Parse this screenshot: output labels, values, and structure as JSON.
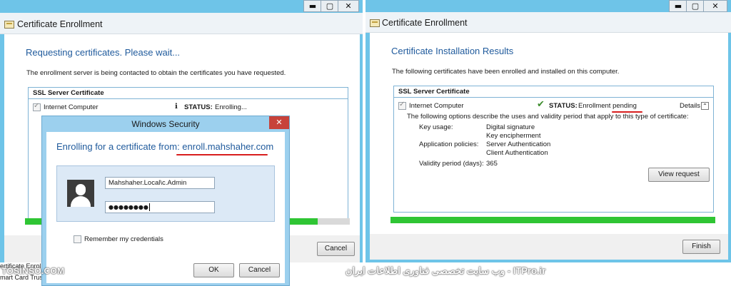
{
  "left_window": {
    "title": "Certificate Enrollment",
    "heading": "Requesting certificates. Please wait...",
    "description": "The enrollment server is being contacted to obtain the certificates you have requested.",
    "group_title": "SSL Server Certificate",
    "item_label": "Internet Computer",
    "status_label": "STATUS:",
    "status_value": "Enrolling...",
    "cancel_label": "Cancel",
    "progress": 0.9
  },
  "dialog": {
    "title": "Windows Security",
    "heading_prefix": "Enrolling for a certificate from: ",
    "server": "enroll.mahshaher.com",
    "username": "Mahshaher.Local\\c.Admin",
    "password_mask": "●●●●●●●●",
    "remember_label": "Remember my credentials",
    "ok_label": "OK",
    "cancel_label": "Cancel",
    "close_glyph": "✕"
  },
  "right_window": {
    "title": "Certificate Enrollment",
    "heading": "Certificate Installation Results",
    "description": "The following certificates have been enrolled and installed on this computer.",
    "group_title": "SSL Server Certificate",
    "item_label": "Internet Computer",
    "status_label": "STATUS:",
    "status_value_prefix": "Enrollment ",
    "status_value_word": "pending",
    "details_label": "Details",
    "options_text": "The following options describe the uses and validity period that apply to this type of certificate:",
    "key_usage_label": "Key usage:",
    "key_usage_values": [
      "Digital signature",
      "Key encipherment"
    ],
    "app_policies_label": "Application policies:",
    "app_policies_values": [
      "Server Authentication",
      "Client Authentication"
    ],
    "validity_label": "Validity period (days):",
    "validity_value": "365",
    "view_request_label": "View request",
    "finish_label": "Finish",
    "progress": 1.0
  },
  "caption_buttons": [
    "▬",
    "▢",
    "✕"
  ],
  "taskbar": {
    "line1": "ertificate Enrol",
    "line2": "mart Card Trus"
  },
  "watermarks": {
    "left": "TOSINSO.COM",
    "right": "ITPro.ir - وب سایت تخصصی فناوری اطلاعات ایران"
  },
  "colors": {
    "accent_blue": "#1f5a9c",
    "progress_green": "#2fc534",
    "frame_blue": "#6ec4e8",
    "annotation_red": "#d81e1e"
  }
}
